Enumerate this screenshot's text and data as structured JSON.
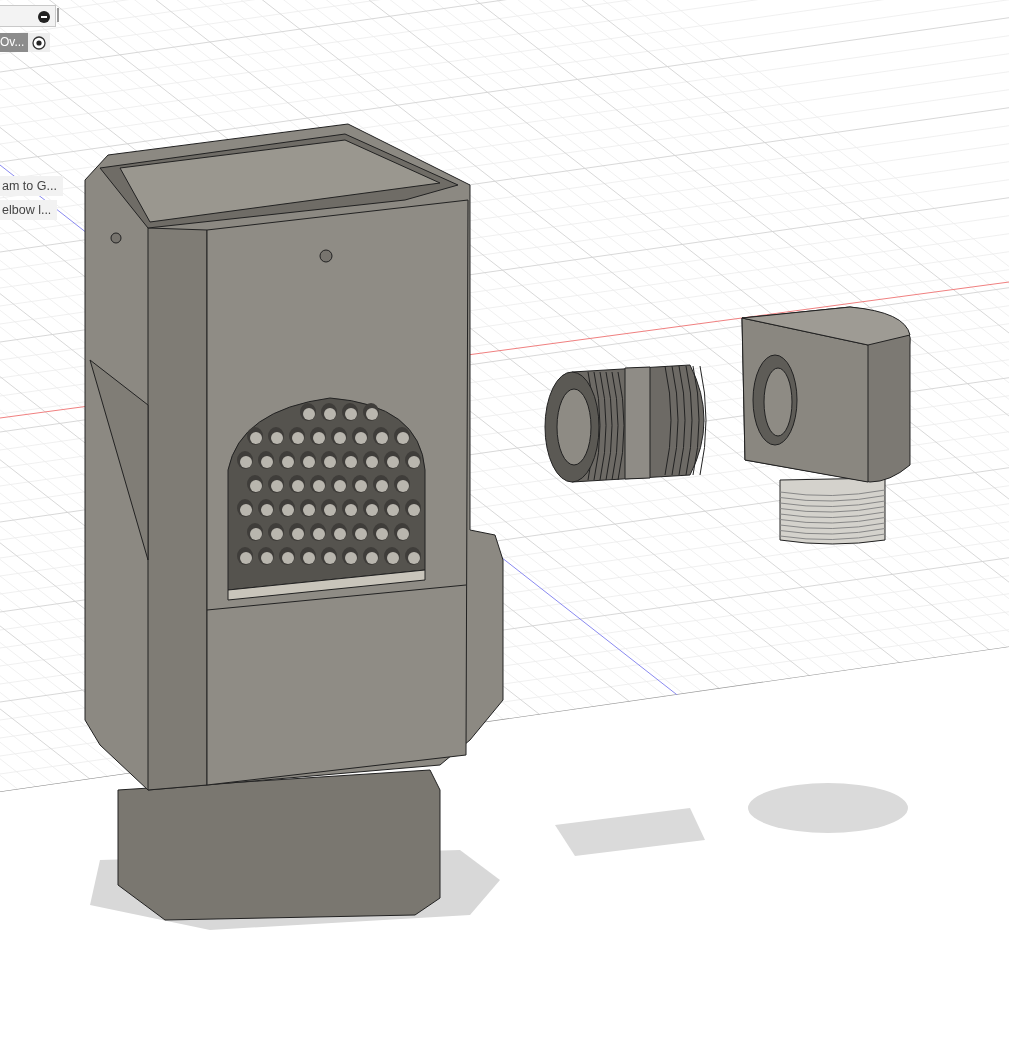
{
  "browser_panel": {
    "active_row": {
      "label": "Ov...",
      "selected": true
    }
  },
  "list_items": [
    {
      "label": "am to G..."
    },
    {
      "label": "elbow l..."
    }
  ]
}
